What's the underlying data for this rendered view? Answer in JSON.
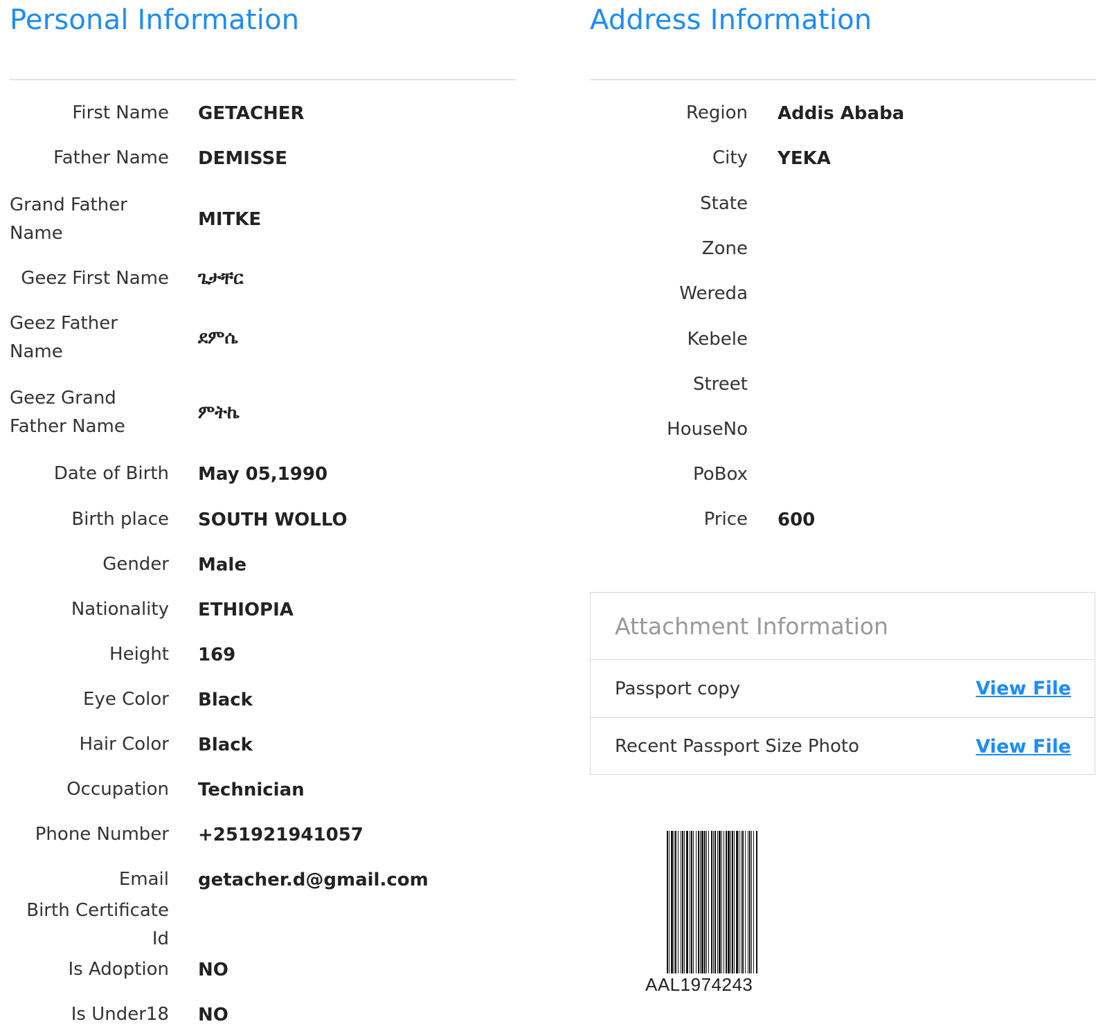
{
  "personal": {
    "title": "Personal Information",
    "rows": [
      {
        "label": "First Name",
        "value": "GETACHER"
      },
      {
        "label": "Father Name",
        "value": "DEMISSE"
      },
      {
        "label": "Grand Father Name",
        "value": "MITKE"
      },
      {
        "label": "Geez First Name",
        "value": "ጌታቸር"
      },
      {
        "label": "Geez Father Name",
        "value": "ደምሴ"
      },
      {
        "label": "Geez Grand Father Name",
        "value": "ምትኬ"
      },
      {
        "label": "Date of Birth",
        "value": "May 05,1990"
      },
      {
        "label": "Birth place",
        "value": "SOUTH WOLLO"
      },
      {
        "label": "Gender",
        "value": "Male"
      },
      {
        "label": "Nationality",
        "value": "ETHIOPIA"
      },
      {
        "label": "Height",
        "value": "169"
      },
      {
        "label": "Eye Color",
        "value": "Black"
      },
      {
        "label": "Hair Color",
        "value": "Black"
      },
      {
        "label": "Occupation",
        "value": "Technician"
      },
      {
        "label": "Phone Number",
        "value": "+251921941057"
      },
      {
        "label": "Email",
        "value": "getacher.d@gmail.com"
      },
      {
        "label": "Birth Certificate Id",
        "value": ""
      },
      {
        "label": "Is Adoption",
        "value": "NO"
      },
      {
        "label": "Is Under18",
        "value": "NO"
      }
    ]
  },
  "address": {
    "title": "Address Information",
    "rows": [
      {
        "label": "Region",
        "value": "Addis Ababa"
      },
      {
        "label": "City",
        "value": "YEKA"
      },
      {
        "label": "State",
        "value": ""
      },
      {
        "label": "Zone",
        "value": ""
      },
      {
        "label": "Wereda",
        "value": ""
      },
      {
        "label": "Kebele",
        "value": ""
      },
      {
        "label": "Street",
        "value": ""
      },
      {
        "label": "HouseNo",
        "value": ""
      },
      {
        "label": "PoBox",
        "value": ""
      },
      {
        "label": "Price",
        "value": "600"
      }
    ]
  },
  "attachments": {
    "title": "Attachment Information",
    "items": [
      {
        "label": "Passport copy",
        "link": "View File"
      },
      {
        "label": "Recent Passport Size Photo",
        "link": "View File"
      }
    ]
  },
  "barcode": {
    "text": "AAL1974243"
  },
  "colors": {
    "accent": "#1a8cff",
    "muted": "#999999"
  }
}
